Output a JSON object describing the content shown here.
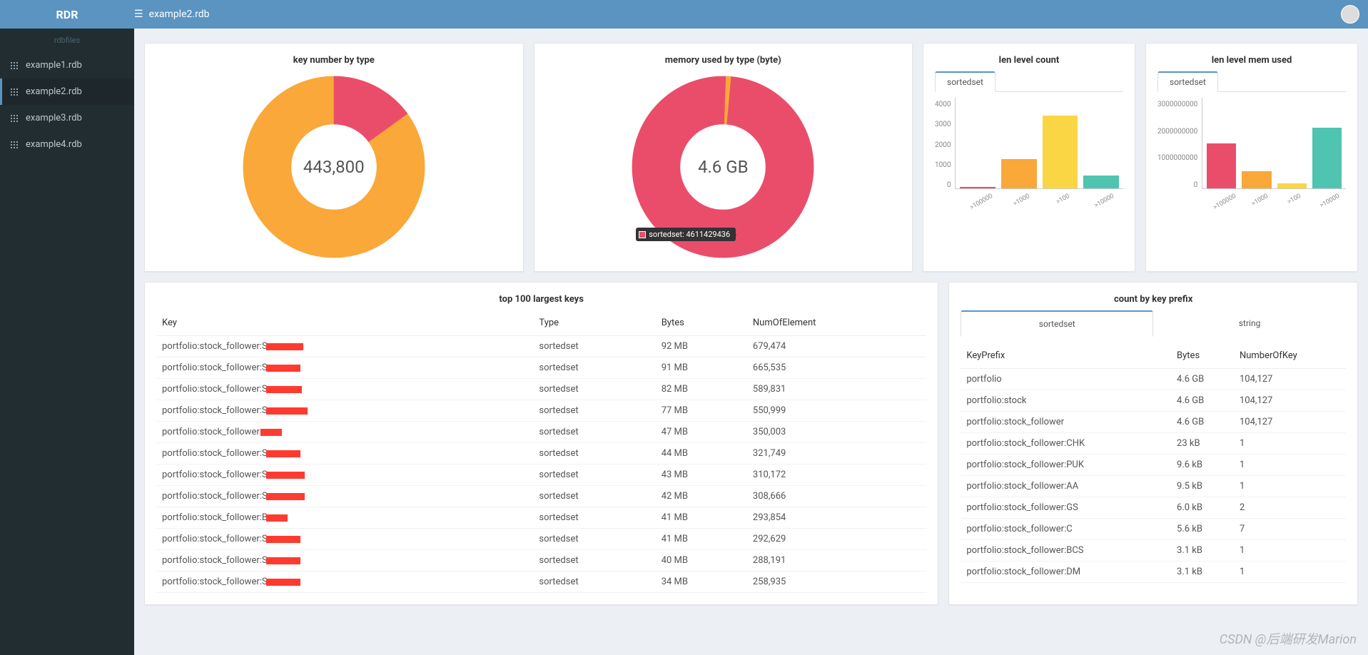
{
  "app": {
    "name": "RDR",
    "current_file": "example2.rdb"
  },
  "sidebar": {
    "header": "rdbfiles",
    "items": [
      {
        "label": "example1.rdb"
      },
      {
        "label": "example2.rdb"
      },
      {
        "label": "example3.rdb"
      },
      {
        "label": "example4.rdb"
      }
    ],
    "active_index": 1
  },
  "donut1": {
    "title": "key number by type",
    "center": "443,800"
  },
  "donut2": {
    "title": "memory used by type (byte)",
    "center": "4.6 GB",
    "tooltip": "sortedset: 4611429436"
  },
  "barcard1": {
    "title": "len level count",
    "tab": "sortedset",
    "yticks": [
      "4000",
      "3000",
      "2000",
      "1000",
      "0"
    ]
  },
  "barcard2": {
    "title": "len level mem used",
    "tab": "sortedset",
    "yticks": [
      "3000000000",
      "2000000000",
      "1000000000",
      "0"
    ]
  },
  "chart_data": [
    {
      "type": "donut",
      "title": "key number by type",
      "total_label": "443,800",
      "series": [
        {
          "name": "orange-segment",
          "value": 85,
          "color": "#f9a839"
        },
        {
          "name": "pink-segment",
          "value": 15,
          "color": "#ea4d6a"
        }
      ]
    },
    {
      "type": "donut",
      "title": "memory used by type (byte)",
      "total_label": "4.6 GB",
      "series": [
        {
          "name": "sortedset",
          "value": 4611429436,
          "color": "#ea4d6a"
        },
        {
          "name": "orange-segment",
          "value": 46000000,
          "color": "#f9a839"
        }
      ]
    },
    {
      "type": "bar",
      "title": "len level count",
      "categories": [
        ">100000",
        ">1000",
        ">100",
        ">10000"
      ],
      "values": [
        80,
        1400,
        3450,
        600
      ],
      "ylim": [
        0,
        4000
      ],
      "legend": [
        "sortedset"
      ]
    },
    {
      "type": "bar",
      "title": "len level mem used",
      "categories": [
        ">100000",
        ">1000",
        ">100",
        ">10000"
      ],
      "values": [
        1600000000,
        620000000,
        170000000,
        2150000000
      ],
      "ylim": [
        0,
        3000000000
      ],
      "legend": [
        "sortedset"
      ]
    }
  ],
  "table1": {
    "title": "top 100 largest keys",
    "headers": [
      "Key",
      "Type",
      "Bytes",
      "NumOfElement"
    ],
    "rows": [
      {
        "key": "portfolio:stock_follower:S",
        "rw": 52,
        "type": "sortedset",
        "bytes": "92 MB",
        "num": "679,474"
      },
      {
        "key": "portfolio:stock_follower:S",
        "rw": 48,
        "type": "sortedset",
        "bytes": "91 MB",
        "num": "665,535"
      },
      {
        "key": "portfolio:stock_follower:S",
        "rw": 50,
        "type": "sortedset",
        "bytes": "82 MB",
        "num": "589,831"
      },
      {
        "key": "portfolio:stock_follower:S",
        "rw": 58,
        "type": "sortedset",
        "bytes": "77 MB",
        "num": "550,999"
      },
      {
        "key": "portfolio:stock_follower:",
        "rw": 30,
        "type": "sortedset",
        "bytes": "47 MB",
        "num": "350,003"
      },
      {
        "key": "portfolio:stock_follower:S",
        "rw": 48,
        "type": "sortedset",
        "bytes": "44 MB",
        "num": "321,749"
      },
      {
        "key": "portfolio:stock_follower:S",
        "rw": 54,
        "type": "sortedset",
        "bytes": "43 MB",
        "num": "310,172"
      },
      {
        "key": "portfolio:stock_follower:S",
        "rw": 54,
        "type": "sortedset",
        "bytes": "42 MB",
        "num": "308,666"
      },
      {
        "key": "portfolio:stock_follower:B",
        "rw": 30,
        "type": "sortedset",
        "bytes": "41 MB",
        "num": "293,854"
      },
      {
        "key": "portfolio:stock_follower:S",
        "rw": 48,
        "type": "sortedset",
        "bytes": "41 MB",
        "num": "292,629"
      },
      {
        "key": "portfolio:stock_follower:S",
        "rw": 48,
        "type": "sortedset",
        "bytes": "40 MB",
        "num": "288,191"
      },
      {
        "key": "portfolio:stock_follower:S",
        "rw": 48,
        "type": "sortedset",
        "bytes": "34 MB",
        "num": "258,935"
      }
    ]
  },
  "table2": {
    "title": "count by key prefix",
    "tabs": [
      "sortedset",
      "string"
    ],
    "headers": [
      "KeyPrefix",
      "Bytes",
      "NumberOfKey"
    ],
    "rows": [
      {
        "prefix": "portfolio",
        "bytes": "4.6 GB",
        "num": "104,127"
      },
      {
        "prefix": "portfolio:stock",
        "bytes": "4.6 GB",
        "num": "104,127"
      },
      {
        "prefix": "portfolio:stock_follower",
        "bytes": "4.6 GB",
        "num": "104,127"
      },
      {
        "prefix": "portfolio:stock_follower:CHK",
        "bytes": "23 kB",
        "num": "1"
      },
      {
        "prefix": "portfolio:stock_follower:PUK",
        "bytes": "9.6 kB",
        "num": "1"
      },
      {
        "prefix": "portfolio:stock_follower:AA",
        "bytes": "9.5 kB",
        "num": "1"
      },
      {
        "prefix": "portfolio:stock_follower:GS",
        "bytes": "6.0 kB",
        "num": "2"
      },
      {
        "prefix": "portfolio:stock_follower:C",
        "bytes": "5.6 kB",
        "num": "7"
      },
      {
        "prefix": "portfolio:stock_follower:BCS",
        "bytes": "3.1 kB",
        "num": "1"
      },
      {
        "prefix": "portfolio:stock_follower:DM",
        "bytes": "3.1 kB",
        "num": "1"
      }
    ]
  },
  "watermark": "CSDN @后端研发Marion"
}
